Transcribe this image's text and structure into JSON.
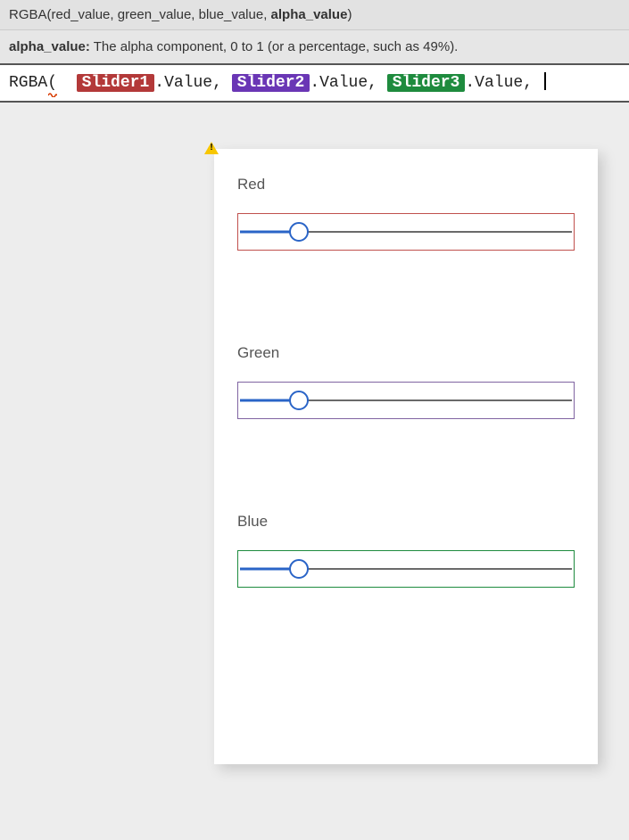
{
  "signature": {
    "fn": "RGBA",
    "params_plain": "red_value, green_value, blue_value,",
    "param_bold": "alpha_value",
    "close": ")"
  },
  "param_help": {
    "name": "alpha_value:",
    "desc": " The alpha component, 0 to 1 (or a percentage, such as 49%)."
  },
  "formula": {
    "fn": "RGBA",
    "open": "(",
    "slider1": "Slider1",
    "slider2": "Slider2",
    "slider3": "Slider3",
    "dotvalue": ".Value",
    "comma": ", "
  },
  "sliders": [
    {
      "label": "Red",
      "color": "red",
      "position_pct": 18
    },
    {
      "label": "Green",
      "color": "purple",
      "position_pct": 18
    },
    {
      "label": "Blue",
      "color": "green",
      "position_pct": 18
    }
  ]
}
